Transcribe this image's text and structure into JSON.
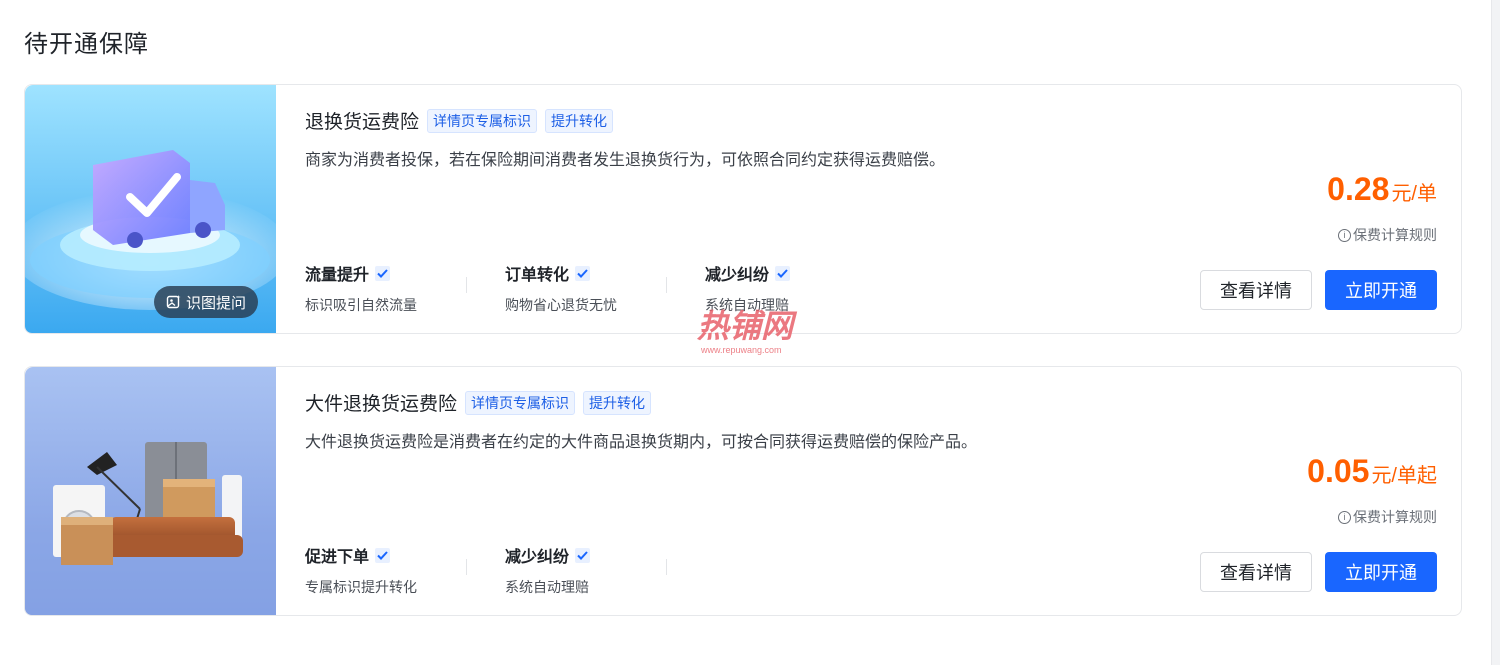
{
  "section_title": "待开通保障",
  "common": {
    "detail_label": "查看详情",
    "open_label": "立即开通",
    "rule_label": "保费计算规则",
    "ocr_label": "识图提问",
    "info_symbol": "i"
  },
  "cards": [
    {
      "name": "退换货运费险",
      "tags": [
        "详情页专属标识",
        "提升转化"
      ],
      "description": "商家为消费者投保，若在保险期间消费者发生退换货行为，可依照合同约定获得运费赔偿。",
      "features": [
        {
          "title": "流量提升",
          "desc": "标识吸引自然流量"
        },
        {
          "title": "订单转化",
          "desc": "购物省心退货无忧"
        },
        {
          "title": "减少纠纷",
          "desc": "系统自动理赔"
        }
      ],
      "price": "0.28",
      "price_unit": "元/单"
    },
    {
      "name": "大件退换货运费险",
      "tags": [
        "详情页专属标识",
        "提升转化"
      ],
      "description": "大件退换货运费险是消费者在约定的大件商品退换货期内，可按合同获得运费赔偿的保险产品。",
      "features": [
        {
          "title": "促进下单",
          "desc": "专属标识提升转化"
        },
        {
          "title": "减少纠纷",
          "desc": "系统自动理赔"
        }
      ],
      "price": "0.05",
      "price_unit": "元/单起"
    }
  ],
  "watermark": {
    "logo": "热铺网",
    "url": "www.repuwang.com"
  },
  "colors": {
    "accent": "#1966ff",
    "price": "#ff5f00",
    "tag_text": "#1d5fe6"
  }
}
